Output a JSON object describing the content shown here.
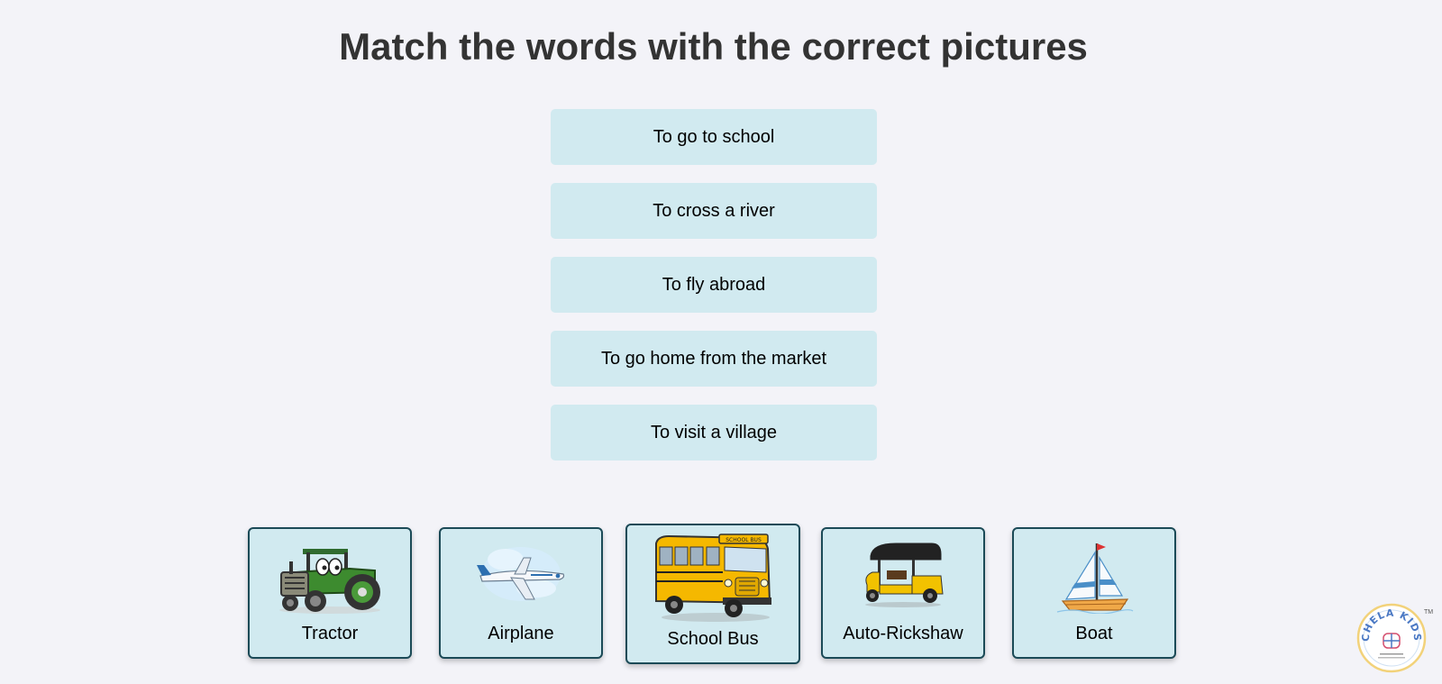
{
  "page": {
    "title": "Match the words with the correct pictures"
  },
  "phrases": [
    "To go to school",
    "To cross a river",
    "To fly abroad",
    "To go home from the market",
    "To visit a village"
  ],
  "cards": [
    {
      "label": "Tractor",
      "icon": "tractor-icon"
    },
    {
      "label": "Airplane",
      "icon": "airplane-icon"
    },
    {
      "label": "School Bus",
      "icon": "school-bus-icon",
      "sign_text": "SCHOOL BUS"
    },
    {
      "label": "Auto-Rickshaw",
      "icon": "auto-rickshaw-icon"
    },
    {
      "label": "Boat",
      "icon": "boat-icon"
    }
  ],
  "logo": {
    "brand": "CHELA KIDS",
    "trademark": "TM"
  },
  "colors": {
    "background": "#f3f3f8",
    "phrase_bg": "#d1eaf0",
    "card_border": "#1b4a57",
    "title": "#333333"
  }
}
